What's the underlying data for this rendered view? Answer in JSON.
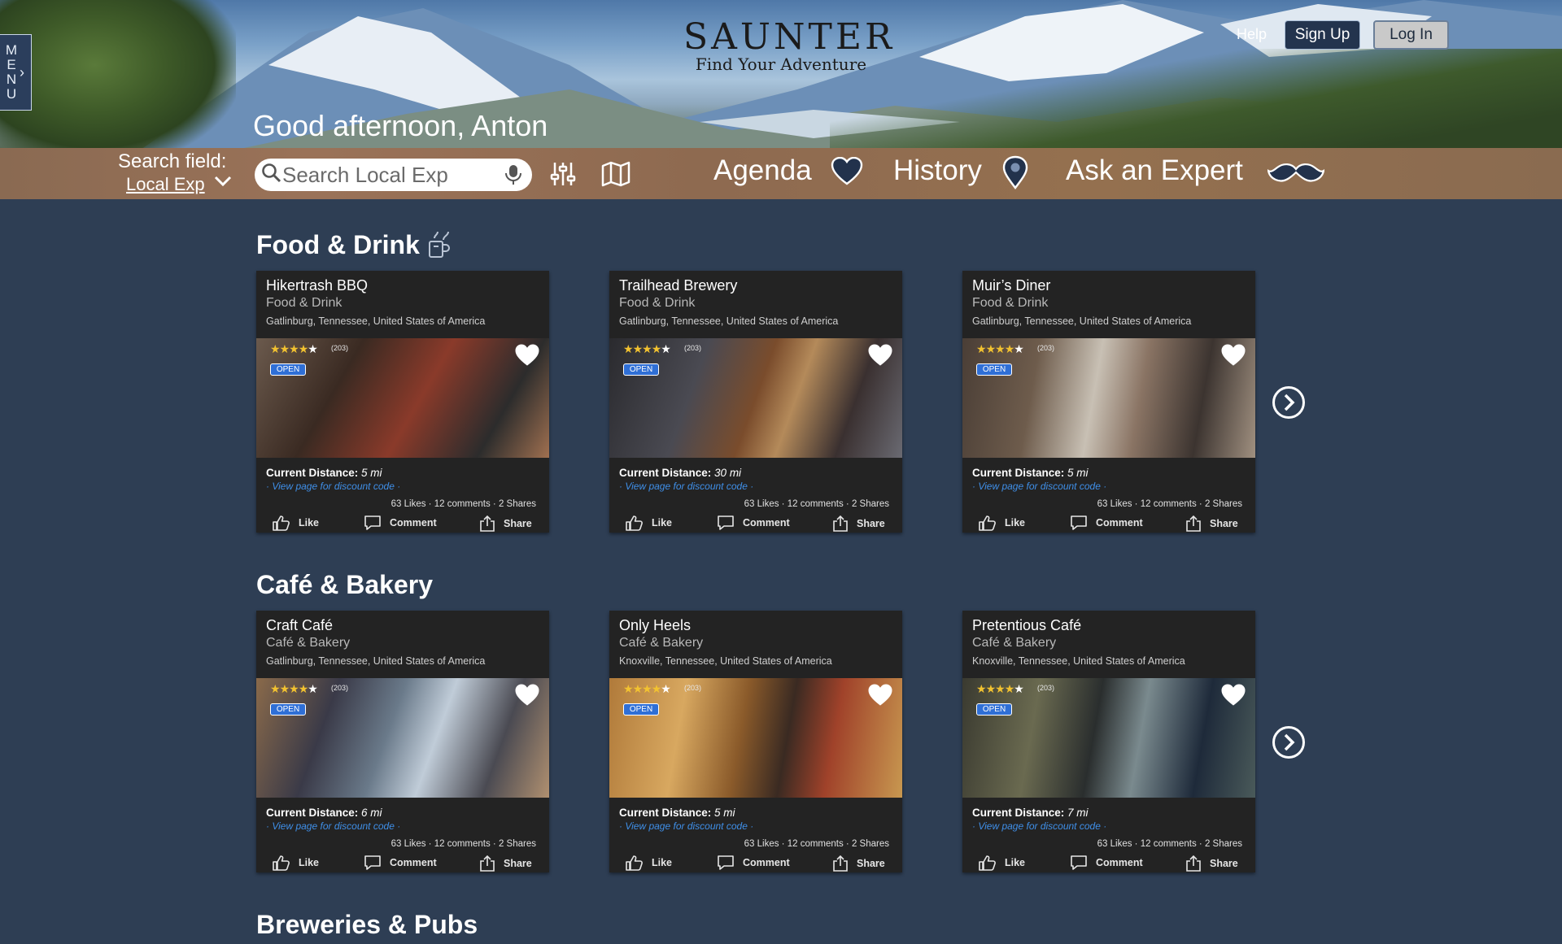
{
  "header": {
    "menu_letters": [
      "M",
      "E",
      "N",
      "U"
    ],
    "brand": "SAUNTER",
    "tagline": "Find Your Adventure",
    "help_label": "Help",
    "signup_label": "Sign Up",
    "login_label": "Log In",
    "greeting": "Good afternoon, Anton"
  },
  "search": {
    "label": "Search field:",
    "scope": "Local Exp",
    "placeholder": "Search Local Exp"
  },
  "nav": {
    "agenda": "Agenda",
    "history": "History",
    "ask_expert": "Ask an Expert"
  },
  "sections": [
    {
      "title": "Food & Drink",
      "cards": [
        {
          "name": "Hikertrash BBQ",
          "category": "Food & Drink",
          "location": "Gatlinburg, Tennessee, United States of America",
          "rating_count": "(203)",
          "status": "OPEN",
          "distance_label": "Current Distance:",
          "distance": "5 mi",
          "discount": "· View page for discount code ·",
          "stats": "63 Likes · 12 comments · 2 Shares"
        },
        {
          "name": "Trailhead Brewery",
          "category": "Food & Drink",
          "location": "Gatlinburg, Tennessee, United States of America",
          "rating_count": "(203)",
          "status": "OPEN",
          "distance_label": "Current Distance:",
          "distance": "30 mi",
          "discount": "· View page for discount code ·",
          "stats": "63 Likes · 12 comments · 2 Shares"
        },
        {
          "name": "Muir’s Diner",
          "category": "Food & Drink",
          "location": "Gatlinburg, Tennessee, United States of America",
          "rating_count": "(203)",
          "status": "OPEN",
          "distance_label": "Current Distance:",
          "distance": "5 mi",
          "discount": "· View page for discount code ·",
          "stats": "63 Likes · 12 comments · 2 Shares"
        }
      ]
    },
    {
      "title": "Café & Bakery",
      "cards": [
        {
          "name": "Craft Café",
          "category": "Café & Bakery",
          "location": "Gatlinburg, Tennessee, United States of America",
          "rating_count": "(203)",
          "status": "OPEN",
          "distance_label": "Current Distance:",
          "distance": "6 mi",
          "discount": "· View page for discount code ·",
          "stats": "63 Likes · 12 comments · 2 Shares"
        },
        {
          "name": "Only Heels",
          "category": "Café & Bakery",
          "location": "Knoxville, Tennessee, United States of America",
          "rating_count": "(203)",
          "status": "OPEN",
          "distance_label": "Current Distance:",
          "distance": "5 mi",
          "discount": "· View page for discount code ·",
          "stats": "63 Likes · 12 comments · 2 Shares"
        },
        {
          "name": "Pretentious Café",
          "category": "Café & Bakery",
          "location": "Knoxville, Tennessee, United States of America",
          "rating_count": "(203)",
          "status": "OPEN",
          "distance_label": "Current Distance:",
          "distance": "7 mi",
          "discount": "· View page for discount code ·",
          "stats": "63 Likes · 12 comments · 2 Shares"
        }
      ]
    },
    {
      "title": "Breweries & Pubs"
    }
  ],
  "card_actions": {
    "like": "Like",
    "comment": "Comment",
    "share": "Share"
  },
  "rating": 4,
  "colors": {
    "page_bg": "#2e3e54",
    "card_bg": "#232323",
    "accent_blue": "#3f8fe8",
    "open_badge": "#2f6fd6",
    "star": "#f2c230"
  }
}
